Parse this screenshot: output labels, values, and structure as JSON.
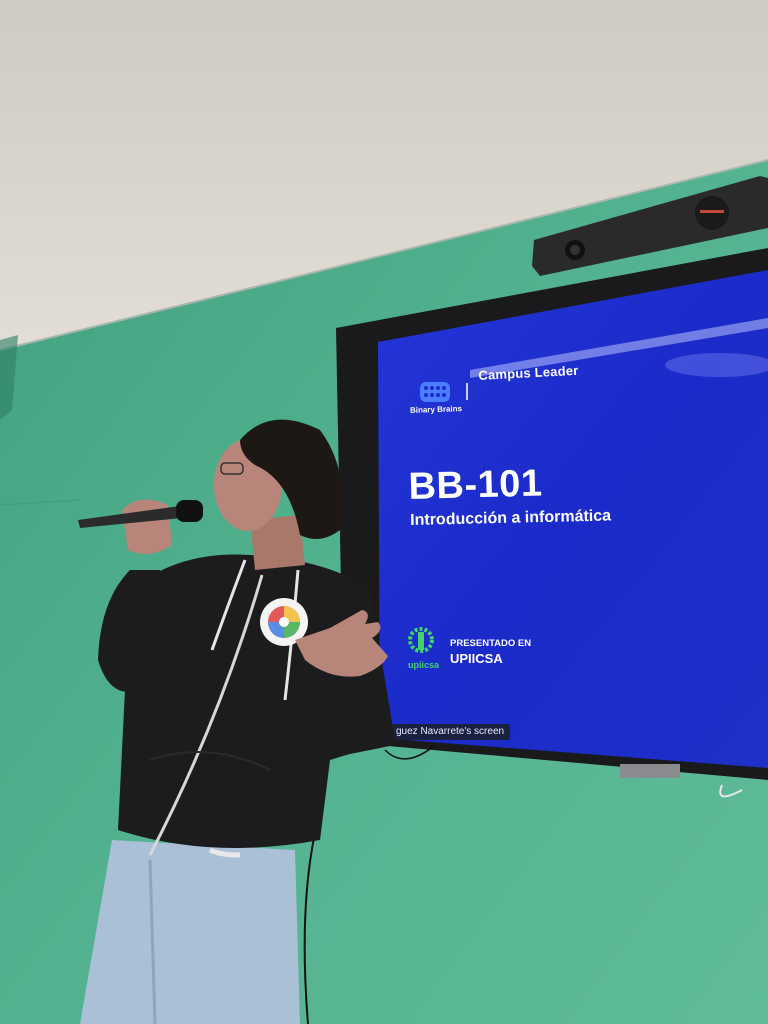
{
  "slide": {
    "brand_name": "Binary Brains",
    "header_role": "Campus Leader",
    "course_code": "BB-101",
    "course_title": "Introducción a informática",
    "presented_label": "PRESENTADO EN",
    "presented_value": "UPIICSA",
    "venue_logo_text": "upiicsa",
    "background_color": "#1f2fd0"
  },
  "screen_share_label": "guez Navarrete's screen",
  "colors": {
    "wall": "#4fae8c",
    "ceiling": "#d8d4cc",
    "hoodie": "#1c1c1e",
    "jeans": "#a9c0d6"
  },
  "icons": [
    "binary-brains-logo-icon",
    "upiicsa-logo-icon",
    "microphone-icon",
    "camera-bar-icon",
    "pin-badge-icon"
  ]
}
